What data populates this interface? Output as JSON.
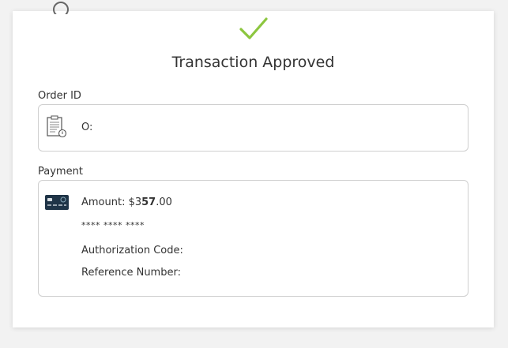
{
  "status": {
    "title": "Transaction Approved"
  },
  "order": {
    "label": "Order ID",
    "value": "O:"
  },
  "payment": {
    "label": "Payment",
    "amount_prefix": "Amount: $3",
    "amount_bold": "57",
    "amount_suffix": ".00",
    "card_mask": "**** **** ****",
    "authorization_label": "Authorization Code:",
    "reference_label": "Reference Number:"
  },
  "colors": {
    "check": "#8cc63f",
    "card_icon": "#1f3447",
    "border": "#cfcfcf"
  },
  "icons": {
    "status": "checkmark-icon",
    "order": "document-icon",
    "payment": "credit-card-icon"
  }
}
